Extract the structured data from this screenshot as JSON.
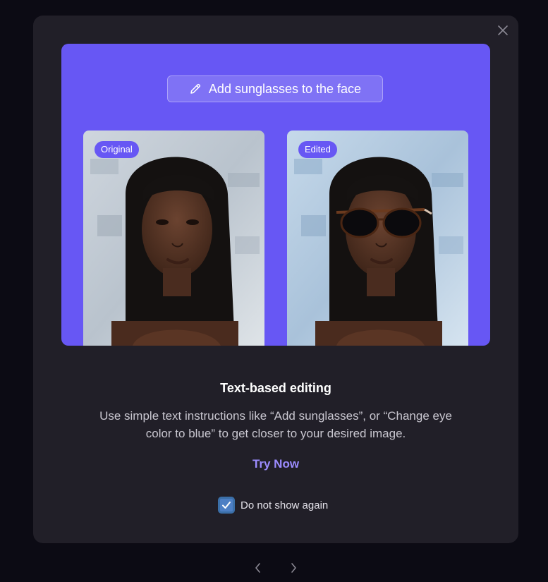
{
  "prompt": {
    "text": "Add sunglasses to the face",
    "icon": "pencil-icon"
  },
  "images": {
    "original_label": "Original",
    "edited_label": "Edited"
  },
  "content": {
    "title": "Text-based editing",
    "description": "Use simple text instructions like “Add sunglasses”, or “Change eye color to blue” to get closer to your desired image.",
    "cta": "Try Now"
  },
  "checkbox": {
    "label": "Do not show again",
    "checked": true
  },
  "colors": {
    "accent": "#6757f4",
    "cta": "#9c8cff",
    "modal_bg": "#211f28",
    "backdrop": "#0c0b14"
  }
}
